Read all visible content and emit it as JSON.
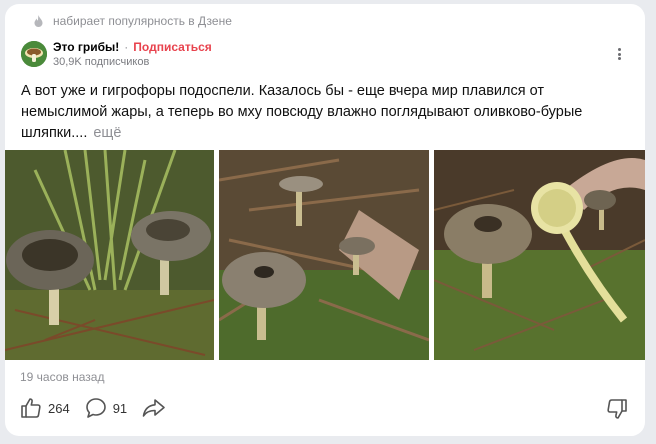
{
  "trending_label": "набирает популярность в Дзене",
  "channel": {
    "name": "Это грибы!",
    "separator": "·",
    "subscribe_label": "Подписаться",
    "subscribers": "30,9K подписчиков"
  },
  "post": {
    "text": "А вот уже и гигрофоры подоспели. Казалось бы - еще вчера мир плавился от немыслимой жары, а теперь во мху повсюду влажно поглядывают оливково-бурые шляпки....",
    "more_label": "ещё",
    "time": "19 часов назад"
  },
  "actions": {
    "likes": "264",
    "comments": "91"
  },
  "colors": {
    "accent": "#e8434e",
    "muted": "#8e8f94",
    "background": "#e9ebef",
    "card": "#ffffff"
  },
  "icons": {
    "trending": "flame-icon",
    "menu": "more-vertical-icon",
    "like": "thumbs-up-icon",
    "comment": "comment-icon",
    "share": "share-icon",
    "dislike": "thumbs-down-icon"
  }
}
